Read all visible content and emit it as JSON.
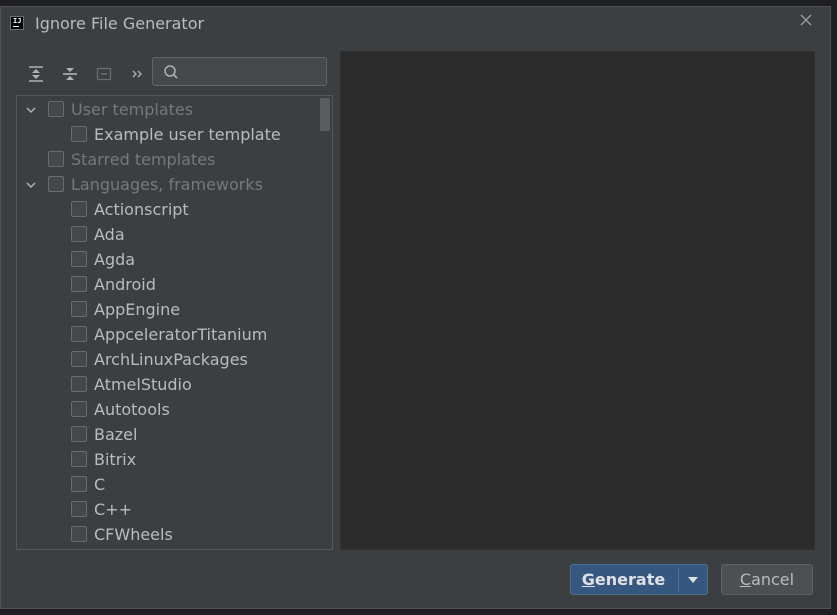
{
  "window": {
    "title": "Ignore File Generator"
  },
  "toolbar": {
    "expand_all_icon": "expand-all-icon",
    "collapse_all_icon": "collapse-all-icon",
    "uncheck_icon": "uncheck-all-icon",
    "more_icon": "more-chevrons-icon",
    "search_value": "",
    "search_placeholder": ""
  },
  "tree": {
    "groups": [
      {
        "label": "User templates",
        "expanded": true,
        "checked": false
      },
      {
        "label": "Example user template",
        "checked": false
      },
      {
        "label": "Starred templates",
        "checked": false
      },
      {
        "label": "Languages, frameworks",
        "expanded": true,
        "checked": false
      }
    ],
    "items": [
      {
        "label": "Actionscript",
        "checked": false
      },
      {
        "label": "Ada",
        "checked": false
      },
      {
        "label": "Agda",
        "checked": false
      },
      {
        "label": "Android",
        "checked": false
      },
      {
        "label": "AppEngine",
        "checked": false
      },
      {
        "label": "AppceleratorTitanium",
        "checked": false
      },
      {
        "label": "ArchLinuxPackages",
        "checked": false
      },
      {
        "label": "AtmelStudio",
        "checked": false
      },
      {
        "label": "Autotools",
        "checked": false
      },
      {
        "label": "Bazel",
        "checked": false
      },
      {
        "label": "Bitrix",
        "checked": false
      },
      {
        "label": "C",
        "checked": false
      },
      {
        "label": "C++",
        "checked": false
      },
      {
        "label": "CFWheels",
        "checked": false
      }
    ]
  },
  "buttons": {
    "generate_mnemonic": "G",
    "generate_rest": "enerate",
    "cancel_mnemonic": "C",
    "cancel_rest": "ancel"
  },
  "colors": {
    "dialog_bg": "#3c3f41",
    "preview_bg": "#2b2b2b",
    "primary_button": "#365880"
  }
}
